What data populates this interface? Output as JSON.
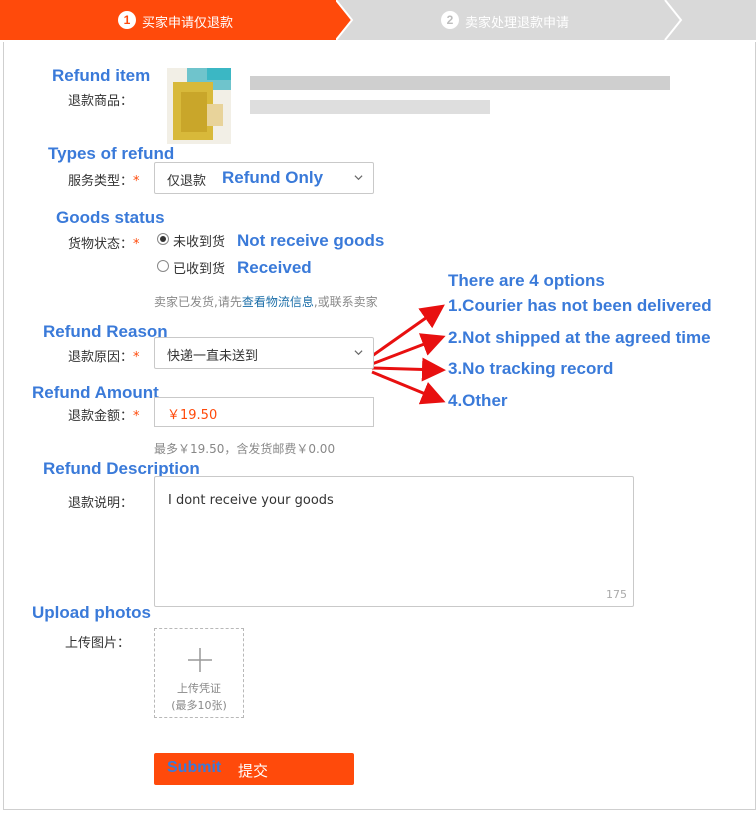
{
  "steps": [
    {
      "num": "1",
      "label": "买家申请仅退款"
    },
    {
      "num": "2",
      "label": "卖家处理退款申请"
    }
  ],
  "refund_item": {
    "annotation": "Refund item",
    "label": "退款商品："
  },
  "refund_type": {
    "annotation": "Types of refund",
    "label": "服务类型：",
    "required_mark": "*",
    "selected": "仅退款",
    "selected_annotation": "Refund Only"
  },
  "goods_status": {
    "annotation": "Goods status",
    "label": "货物状态：",
    "required_mark": "*",
    "options": [
      {
        "label": "未收到货",
        "annotation": "Not receive goods",
        "checked": true
      },
      {
        "label": "已收到货",
        "annotation": "Received",
        "checked": false
      }
    ],
    "tip_before": "卖家已发货,请先",
    "tip_link": "查看物流信息",
    "tip_after": ",或联系卖家"
  },
  "refund_reason": {
    "annotation": "Refund Reason",
    "label": "退款原因：",
    "required_mark": "*",
    "selected": "快递一直未送到",
    "options_heading": "There are 4 options",
    "options": [
      "1.Courier has not been delivered",
      "2.Not shipped at the agreed time",
      "3.No tracking record",
      "4.Other"
    ]
  },
  "refund_amount": {
    "annotation": "Refund Amount",
    "label": "退款金额：",
    "required_mark": "*",
    "value": "￥19.50",
    "hint": "最多￥19.50，含发货邮费￥0.00"
  },
  "refund_description": {
    "annotation": "Refund Description",
    "label": "退款说明：",
    "value": "I dont receive your goods",
    "char_count": "175"
  },
  "upload": {
    "annotation": "Upload photos",
    "label": "上传图片：",
    "button_line1": "上传凭证",
    "button_line2": "(最多10张)"
  },
  "submit": {
    "annotation": "Submit",
    "label": "提交"
  },
  "colors": {
    "accent": "#ff4a0b",
    "annotation_blue": "#3a7ad9",
    "arrow_red": "#e81010"
  }
}
